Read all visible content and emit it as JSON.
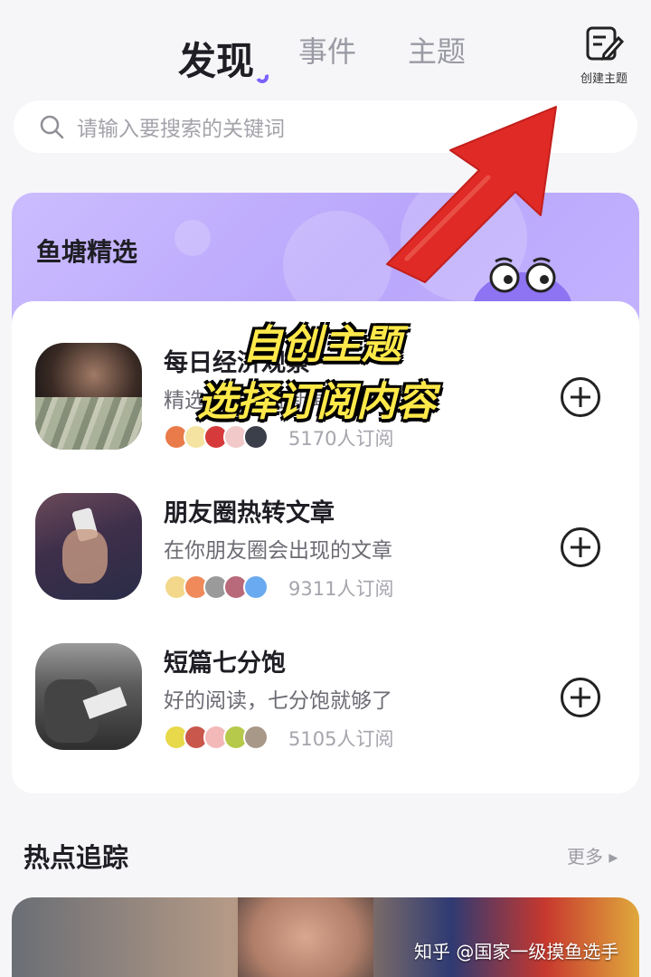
{
  "tabs": [
    {
      "label": "发现",
      "active": true
    },
    {
      "label": "事件",
      "active": false
    },
    {
      "label": "主题",
      "active": false
    }
  ],
  "create": {
    "label": "创建主题",
    "icon": "edit-icon"
  },
  "search": {
    "placeholder": "请输入要搜索的关键词",
    "icon": "search-icon"
  },
  "pond": {
    "title": "鱼塘精选",
    "items": [
      {
        "title": "每日经济观察",
        "desc": "精选经济财经新闻",
        "subs": "5170人订阅"
      },
      {
        "title": "朋友圈热转文章",
        "desc": "在你朋友圈会出现的文章",
        "subs": "9311人订阅"
      },
      {
        "title": "短篇七分饱",
        "desc": "好的阅读，七分饱就够了",
        "subs": "5105人订阅"
      }
    ]
  },
  "hot": {
    "title": "热点追踪",
    "more": "更多 ▸"
  },
  "overlay": {
    "line1": "自创主题",
    "line2": "选择订阅内容"
  },
  "watermark": "知乎 @国家一级摸鱼选手",
  "colors": {
    "accent": "#7b61ff",
    "overlay_yellow": "#ffe94a",
    "arrow_red": "#e02a26"
  }
}
